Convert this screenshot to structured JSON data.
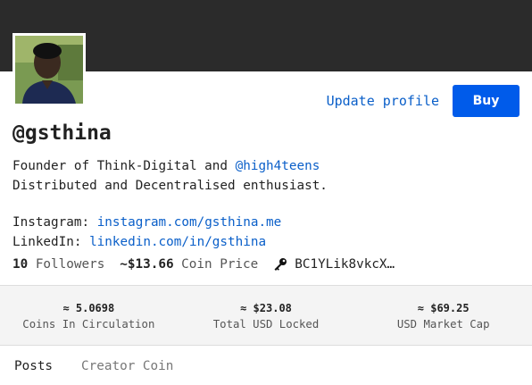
{
  "profile": {
    "username": "@gsthina",
    "update_label": "Update profile",
    "buy_label": "Buy",
    "bio_line1_prefix": "Founder of Think-Digital and ",
    "bio_mention": "@high4teens",
    "bio_line2": "Distributed and Decentralised enthusiast."
  },
  "social": {
    "instagram_label": "Instagram: ",
    "instagram_link": "instagram.com/gsthina.me",
    "linkedin_label": "LinkedIn: ",
    "linkedin_link": "linkedin.com/in/gsthina"
  },
  "stats": {
    "followers_count": "10",
    "followers_label": "Followers",
    "coin_price": "~$13.66",
    "coin_price_label": "Coin Price",
    "public_key": "BC1YLik8vkcX…"
  },
  "metrics": [
    {
      "value": "≈ 5.0698",
      "label": "Coins In Circulation"
    },
    {
      "value": "≈ $23.08",
      "label": "Total USD Locked"
    },
    {
      "value": "≈ $69.25",
      "label": "USD Market Cap"
    }
  ],
  "tabs": [
    {
      "label": "Posts"
    },
    {
      "label": "Creator Coin"
    }
  ],
  "colors": {
    "accent": "#005bea",
    "link": "#0a5fc9",
    "cover": "#2b2b2b"
  }
}
